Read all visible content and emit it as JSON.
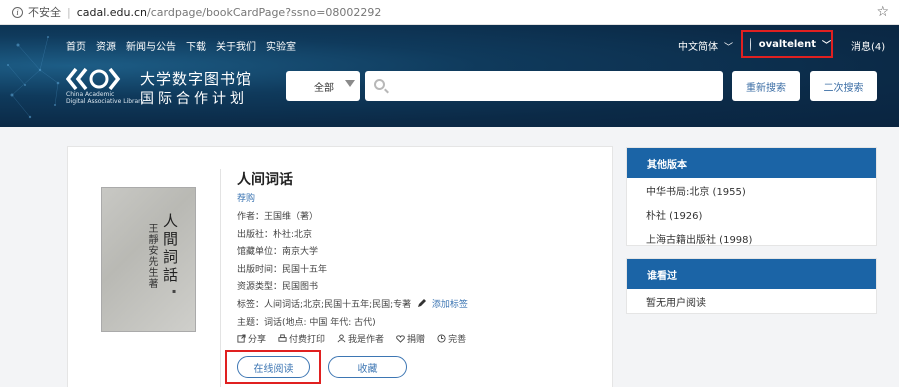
{
  "urlbar": {
    "security_label": "不安全",
    "host": "cadal.edu.cn",
    "path": "/cardpage/bookCardPage?ssno=08002292"
  },
  "nav": {
    "items": [
      "首页",
      "资源",
      "新闻与公告",
      "下载",
      "关于我们",
      "实验室"
    ],
    "language": "中文简体",
    "username": "ovaltelent",
    "messages": "消息(4)"
  },
  "logo": {
    "en_line1": "China Academic",
    "en_line2": "Digital Associative Library",
    "cn_line1": "大学数字图书馆",
    "cn_line2": "国际合作计划"
  },
  "search": {
    "scope": "全部",
    "placeholder": "",
    "research_label": "重新搜索",
    "second_label": "二次搜索"
  },
  "book": {
    "title": "人间词话",
    "recommend": "荐购",
    "cover_title": "人間詞話",
    "cover_author": "王靜安先生著",
    "author_label": "作者：王国维（著）",
    "publisher_label": "出版社：朴社:北京",
    "holder_label": "馆藏单位：南京大学",
    "pubdate_label": "出版时间：民国十五年",
    "restype_label": "资源类型：民国图书",
    "tags_label": "标签：人间词话;北京;民国十五年;民国;专著",
    "add_tag": "添加标签",
    "subject_label": "主题：词话(地点: 中国 年代: 古代)",
    "actions": [
      "分享",
      "付费打印",
      "我是作者",
      "捐赠",
      "完善"
    ],
    "read_label": "在线阅读",
    "collect_label": "收藏"
  },
  "sidebar": {
    "other_versions_title": "其他版本",
    "other_versions": [
      "中华书局:北京 (1955)",
      "朴社 (1926)",
      "上海古籍出版社 (1998)"
    ],
    "viewers_title": "谁看过",
    "viewers_empty": "暂无用户阅读"
  },
  "colors": {
    "header_bg": "#0b2a47",
    "accent": "#1b64a6",
    "link": "#3d76b3",
    "highlight_border": "#e02020"
  }
}
